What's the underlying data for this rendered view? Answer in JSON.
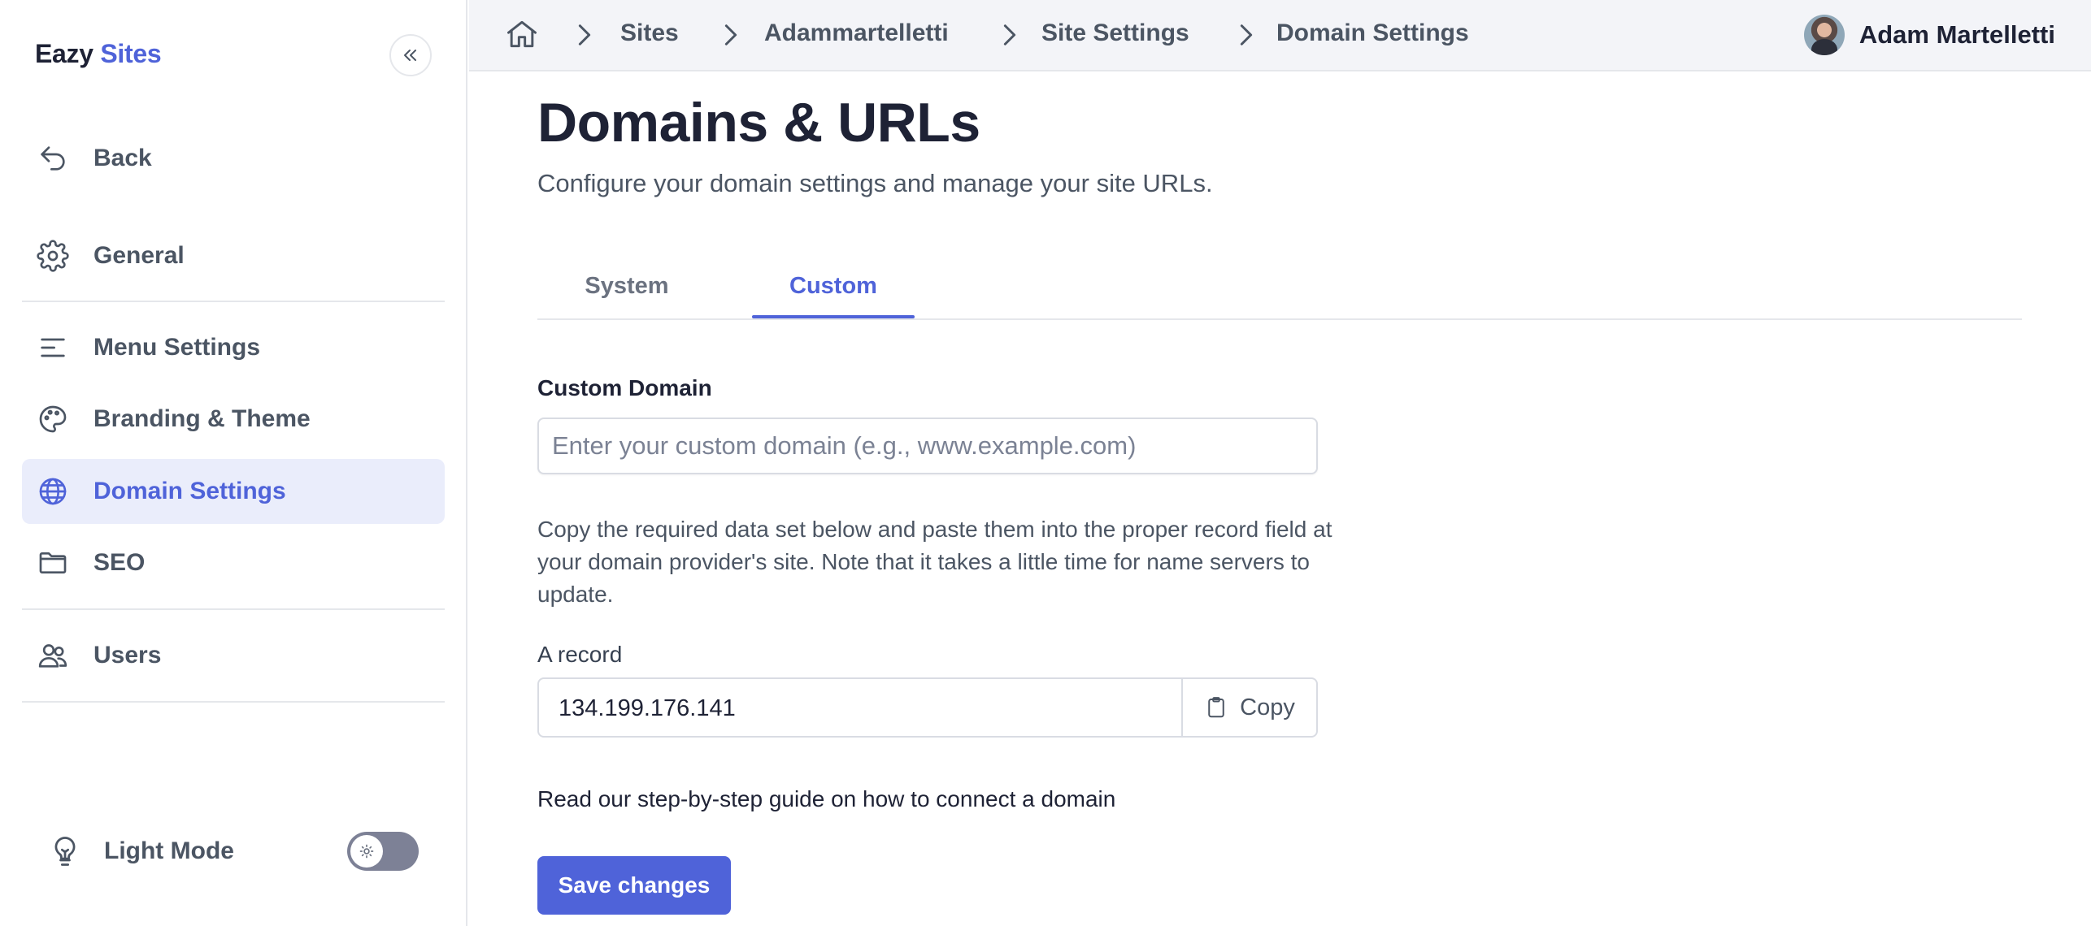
{
  "brand": {
    "name_part1": "Eazy",
    "name_part2": "Sites"
  },
  "sidebar": {
    "items": [
      {
        "label": "Back",
        "icon": "back-arrow-icon"
      },
      {
        "label": "General",
        "icon": "gear-icon"
      },
      {
        "label": "Menu Settings",
        "icon": "menu-lines-icon"
      },
      {
        "label": "Branding & Theme",
        "icon": "palette-icon"
      },
      {
        "label": "Domain Settings",
        "icon": "globe-icon",
        "active": true
      },
      {
        "label": "SEO",
        "icon": "folder-icon"
      },
      {
        "label": "Users",
        "icon": "users-icon"
      }
    ],
    "light_mode_label": "Light Mode",
    "light_mode_on": false
  },
  "breadcrumb": {
    "items": [
      "Sites",
      "Adammartelletti",
      "Site Settings",
      "Domain Settings"
    ]
  },
  "user": {
    "name": "Adam Martelletti"
  },
  "page": {
    "title": "Domains & URLs",
    "subtitle": "Configure your domain settings and manage your site URLs."
  },
  "tabs": [
    {
      "label": "System"
    },
    {
      "label": "Custom",
      "active": true
    }
  ],
  "custom_domain": {
    "label": "Custom Domain",
    "value": "",
    "placeholder": "Enter your custom domain (e.g., www.example.com)",
    "help_text": "Copy the required data set below and paste them into the proper record field at your domain provider's site. Note that it takes a little time for name servers to update."
  },
  "a_record": {
    "label": "A record",
    "value": "134.199.176.141",
    "copy_label": "Copy"
  },
  "guide_text": "Read our step-by-step guide on how to connect a domain",
  "save_label": "Save changes",
  "colors": {
    "accent": "#4f63d9",
    "active_bg": "#eaedfb",
    "text_dark": "#1e2235",
    "text_muted": "#4b5563"
  }
}
